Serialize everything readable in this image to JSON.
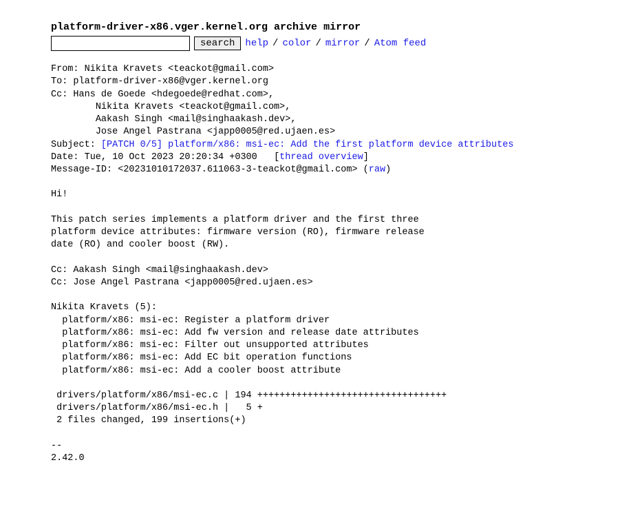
{
  "title": "platform-driver-x86.vger.kernel.org archive mirror",
  "topbar": {
    "search_button": "search",
    "search_value": "",
    "links": {
      "help": "help",
      "color": "color",
      "mirror": "mirror",
      "atom": "Atom feed"
    },
    "sep": "/"
  },
  "msg": {
    "from_label": "From: ",
    "from_value": "Nikita Kravets <teackot@gmail.com>",
    "to_label": "To: ",
    "to_value": "platform-driver-x86@vger.kernel.org",
    "cc_label": "Cc: ",
    "cc_1": "Hans de Goede <hdegoede@redhat.com>,",
    "cc_2": "Nikita Kravets <teackot@gmail.com>,",
    "cc_3": "Aakash Singh <mail@singhaakash.dev>,",
    "cc_4": "Jose Angel Pastrana <japp0005@red.ujaen.es>",
    "subject_label": "Subject: ",
    "subject_value": "[PATCH 0/5] platform/x86: msi-ec: Add the first platform device attributes",
    "date_label": "Date: ",
    "date_value": "Tue, 10 Oct 2023 20:20:34 +0300",
    "thread_overview": "thread overview",
    "msgid_label": "Message-ID: ",
    "msgid_value": "<20231010172037.611063-3-teackot@gmail.com> (",
    "raw": "raw",
    "msgid_close": ")",
    "body_1": "Hi!",
    "body_2": "This patch series implements a platform driver and the first three",
    "body_3": "platform device attributes: firmware version (RO), firmware release",
    "body_4": "date (RO) and cooler boost (RW).",
    "body_5": "Cc: Aakash Singh <mail@singhaakash.dev>",
    "body_6": "Cc: Jose Angel Pastrana <japp0005@red.ujaen.es>",
    "body_7": "Nikita Kravets (5):",
    "body_8": "  platform/x86: msi-ec: Register a platform driver",
    "body_9": "  platform/x86: msi-ec: Add fw version and release date attributes",
    "body_10": "  platform/x86: msi-ec: Filter out unsupported attributes",
    "body_11": "  platform/x86: msi-ec: Add EC bit operation functions",
    "body_12": "  platform/x86: msi-ec: Add a cooler boost attribute",
    "body_13": " drivers/platform/x86/msi-ec.c | 194 ++++++++++++++++++++++++++++++++++",
    "body_14": " drivers/platform/x86/msi-ec.h |   5 +",
    "body_15": " 2 files changed, 199 insertions(+)",
    "body_16": "-- ",
    "body_17": "2.42.0"
  }
}
